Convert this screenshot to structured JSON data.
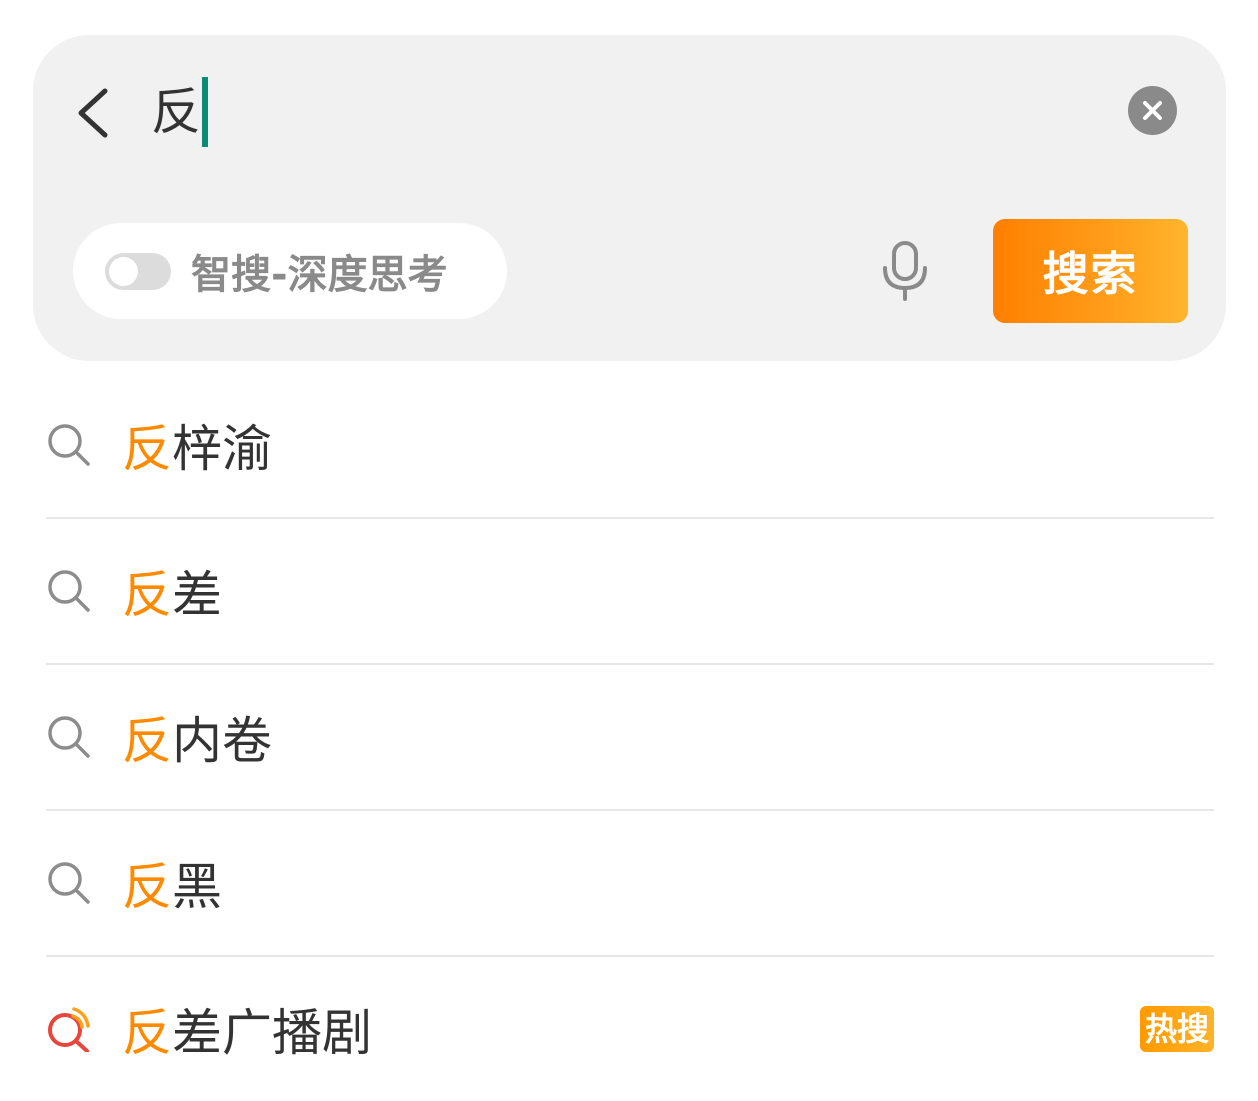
{
  "search": {
    "query": "反",
    "placeholder": "",
    "smart_toggle_label": "智搜-深度思考",
    "smart_toggle_on": false,
    "submit_label": "搜索"
  },
  "suggestions": [
    {
      "highlight": "反",
      "rest": "梓渝",
      "hot": false
    },
    {
      "highlight": "反",
      "rest": "差",
      "hot": false
    },
    {
      "highlight": "反",
      "rest": "内卷",
      "hot": false
    },
    {
      "highlight": "反",
      "rest": "黑",
      "hot": false
    },
    {
      "highlight": "反",
      "rest": "差广播剧",
      "hot": true,
      "badge": "热搜"
    }
  ],
  "icons": {
    "back": "chevron-left-icon",
    "clear": "clear-circle-icon",
    "mic": "microphone-icon",
    "suggest": "search-icon",
    "trending": "trending-search-icon"
  },
  "colors": {
    "accent": "#ff8a00",
    "caret": "#0b8a78",
    "card_bg": "#f1f1f1",
    "trending_icon": "#e8453c"
  }
}
